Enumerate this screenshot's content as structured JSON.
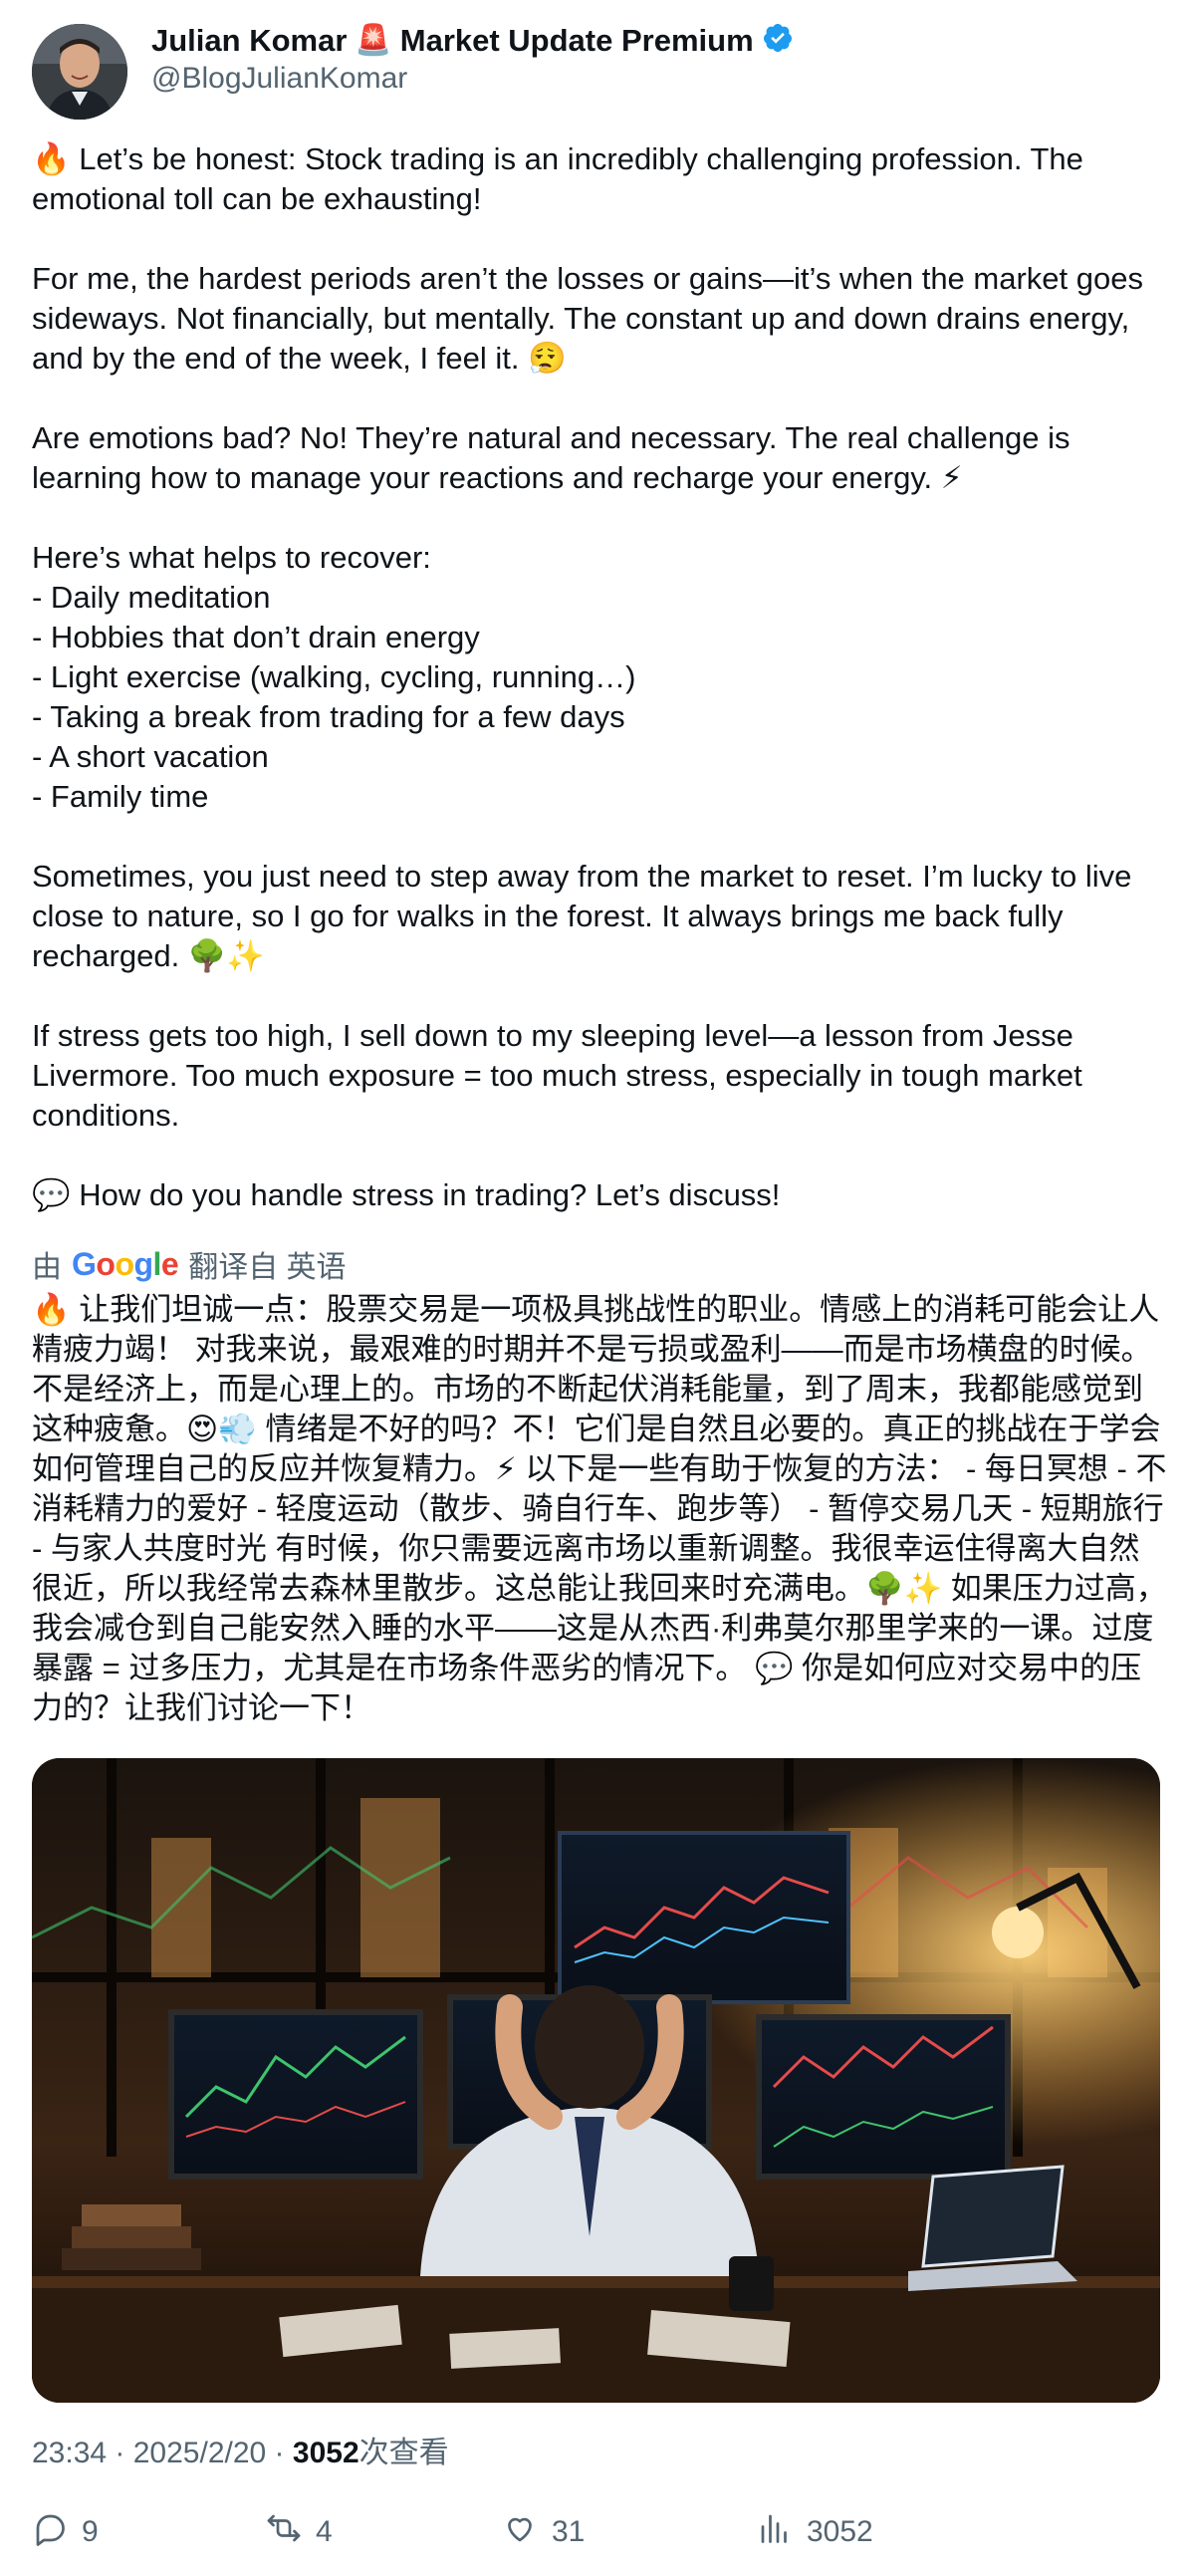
{
  "author": {
    "name": "Julian Komar",
    "siren_emoji": "🚨",
    "name_suffix": "Market Update Premium",
    "handle": "@BlogJulianKomar",
    "verified_color": "#1d9bf0"
  },
  "tweet": {
    "text": "🔥 Let’s be honest: Stock trading is an incredibly challenging profession. The emotional toll can be exhausting!\n\nFor me, the hardest periods aren’t the losses or gains—it’s when the market goes sideways. Not financially, but mentally. The constant up and down drains energy, and by the end of the week, I feel it. 😮‍💨\n\nAre emotions bad? No! They’re natural and necessary. The real challenge is learning how to manage your reactions and recharge your energy. ⚡\n\nHere’s what helps to recover:\n- Daily meditation\n- Hobbies that don’t drain energy\n- Light exercise (walking, cycling, running…)\n- Taking a break from trading for a few days\n- A short vacation\n- Family time\n\nSometimes, you just need to step away from the market to reset. I’m lucky to live close to nature, so I go for walks in the forest. It always brings me back fully recharged. 🌳✨\n\nIf stress gets too high, I sell down to my sleeping level—a lesson from Jesse Livermore. Too much exposure = too much stress, especially in tough market conditions.\n\n💬 How do you handle stress in trading? Let’s discuss!"
  },
  "translation": {
    "prefix": "由",
    "google": "Google",
    "suffix": "翻译自 英语",
    "text": "🔥 让我们坦诚一点：股票交易是一项极具挑战性的职业。情感上的消耗可能会让人精疲力竭！ 对我来说，最艰难的时期并不是亏损或盈利——而是市场横盘的时候。不是经济上，而是心理上的。市场的不断起伏消耗能量，到了周末，我都能感觉到这种疲惫。😍💨 情绪是不好的吗？不！它们是自然且必要的。真正的挑战在于学会如何管理自己的反应并恢复精力。⚡ 以下是一些有助于恢复的方法： - 每日冥想 - 不消耗精力的爱好 - 轻度运动（散步、骑自行车、跑步等） - 暂停交易几天 - 短期旅行 - 与家人共度时光 有时候，你只需要远离市场以重新调整。我很幸运住得离大自然很近，所以我经常去森林里散步。这总能让我回来时充满电。🌳✨ 如果压力过高，我会减仓到自己能安然入睡的水平——这是从杰西·利弗莫尔那里学来的一课。过度暴露 = 过多压力，尤其是在市场条件恶劣的情况下。 💬 你是如何应对交易中的压力的？让我们讨论一下！"
  },
  "meta": {
    "time": "23:34",
    "sep1": " · ",
    "date": "2025/2/20",
    "sep2": " · ",
    "views": "3052",
    "views_label": "次查看"
  },
  "actions": {
    "replies": "9",
    "retweets": "4",
    "likes": "31",
    "views": "3052"
  },
  "icons": [
    "verified-badge-icon",
    "reply-icon",
    "retweet-icon",
    "like-icon",
    "views-icon"
  ]
}
